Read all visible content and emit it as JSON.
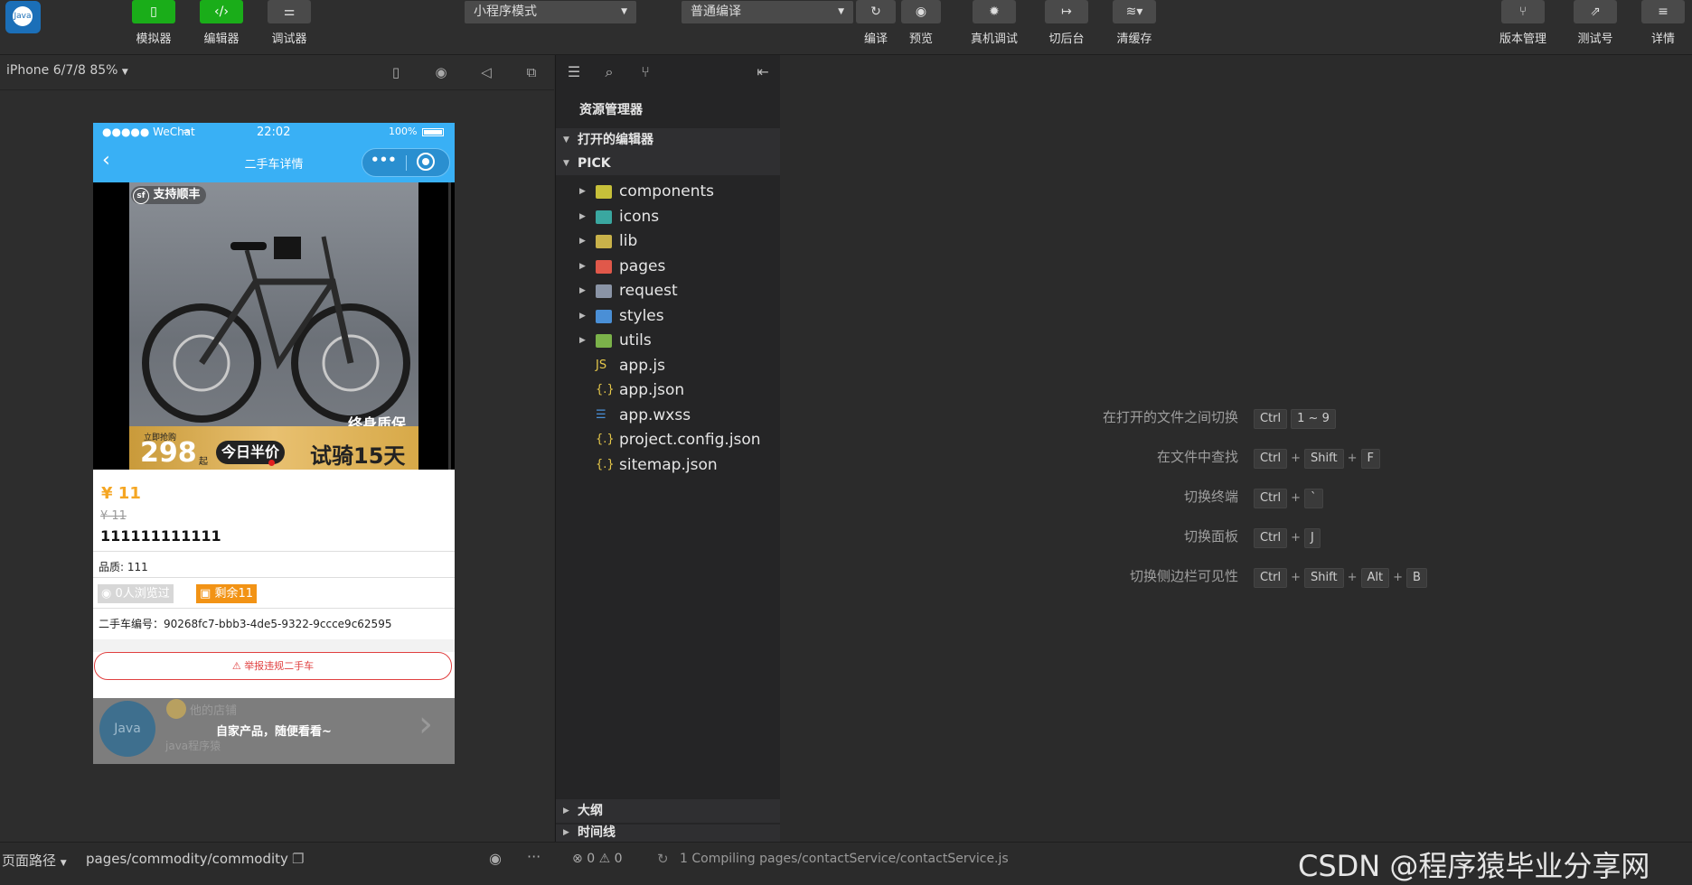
{
  "toolbar": {
    "left_buttons": [
      {
        "label": "模拟器",
        "icon": "phone-icon"
      },
      {
        "label": "编辑器",
        "icon": "code-icon"
      },
      {
        "label": "调试器",
        "icon": "sliders-icon"
      }
    ],
    "mode_select": "小程序模式",
    "compile_select": "普通编译",
    "mid_buttons": [
      {
        "label": "编译",
        "icon": "refresh-icon"
      },
      {
        "label": "预览",
        "icon": "eye-icon"
      },
      {
        "label": "真机调试",
        "icon": "bug-icon"
      },
      {
        "label": "切后台",
        "icon": "switch-icon"
      },
      {
        "label": "清缓存",
        "icon": "layers-icon"
      }
    ],
    "right_buttons": [
      {
        "label": "版本管理",
        "icon": "branch-icon"
      },
      {
        "label": "测试号",
        "icon": "external-icon"
      },
      {
        "label": "详情",
        "icon": "menu-icon"
      }
    ]
  },
  "simulator": {
    "device": "iPhone 6/7/8 85%",
    "status": {
      "carrier": "●●●●● WeChat",
      "time": "22:02",
      "battery": "100%"
    },
    "nav_title": "二手车详情",
    "photo": {
      "badge": "支持顺丰",
      "promo_small": "立即抢购",
      "promo_price": "298",
      "promo_unit": "起",
      "promo_half": "今日半价",
      "promo_trial": "试骑15天",
      "promo_warranty": "终身质保"
    },
    "price": "¥ 11",
    "old_price": "¥ 11",
    "title": "111111111111",
    "quality": "品质: 111",
    "views": "0人浏览过",
    "stock": "剩余11",
    "serial": "二手车编号：90268fc7-bbb3-4de5-9322-9ccce9c62595",
    "report": "举报违规二手车",
    "shop_name": "他的店铺",
    "shop_owner": "java程序猿",
    "overlay_text": "自家产品，随便看看~"
  },
  "explorer": {
    "title": "资源管理器",
    "open_editors": "打开的编辑器",
    "project": "PICK",
    "items": [
      {
        "name": "components",
        "type": "folder",
        "color": "#c7c03a"
      },
      {
        "name": "icons",
        "type": "folder",
        "color": "#3aa7a0"
      },
      {
        "name": "lib",
        "type": "folder",
        "color": "#c9b24a"
      },
      {
        "name": "pages",
        "type": "folder",
        "color": "#e0584a"
      },
      {
        "name": "request",
        "type": "folder",
        "color": "#8a94a6"
      },
      {
        "name": "styles",
        "type": "folder",
        "color": "#4a8fd6"
      },
      {
        "name": "utils",
        "type": "folder",
        "color": "#7bb24a"
      },
      {
        "name": "app.js",
        "type": "js",
        "color": "#e6c84a"
      },
      {
        "name": "app.json",
        "type": "json",
        "color": "#e6c84a"
      },
      {
        "name": "app.wxss",
        "type": "wxss",
        "color": "#4a8fd6"
      },
      {
        "name": "project.config.json",
        "type": "json",
        "color": "#e6c84a"
      },
      {
        "name": "sitemap.json",
        "type": "json",
        "color": "#e6c84a"
      }
    ],
    "outline": "大纲",
    "timeline": "时间线"
  },
  "shortcuts": [
    {
      "label": "在打开的文件之间切换",
      "keys": [
        "Ctrl",
        "1 ~ 9"
      ]
    },
    {
      "label": "在文件中查找",
      "keys": [
        "Ctrl",
        "+",
        "Shift",
        "+",
        "F"
      ]
    },
    {
      "label": "切换终端",
      "keys": [
        "Ctrl",
        "+",
        "`"
      ]
    },
    {
      "label": "切换面板",
      "keys": [
        "Ctrl",
        "+",
        "J"
      ]
    },
    {
      "label": "切换侧边栏可见性",
      "keys": [
        "Ctrl",
        "+",
        "Shift",
        "+",
        "Alt",
        "+",
        "B"
      ]
    }
  ],
  "bottom": {
    "path_label": "页面路径",
    "path": "pages/commodity/commodity",
    "errors": "0",
    "warnings": "0",
    "compile_status": "1 Compiling pages/contactService/contactService.js",
    "watermark": "CSDN @程序猿毕业分享网"
  }
}
